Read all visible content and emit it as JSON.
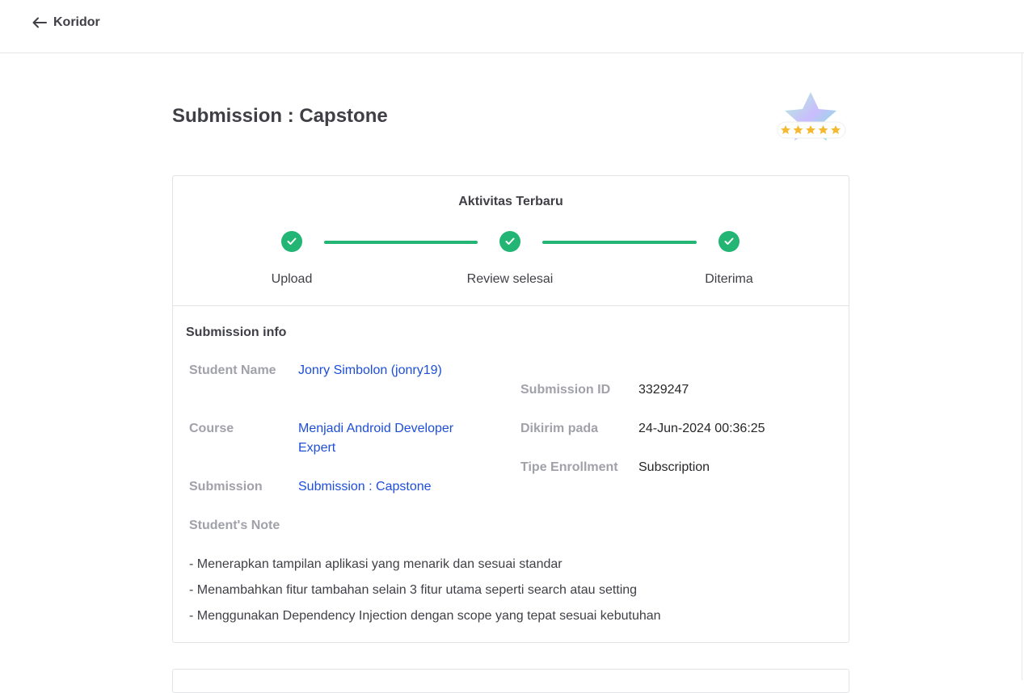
{
  "header": {
    "back_label": "Koridor"
  },
  "page": {
    "title": "Submission : Capstone",
    "badge_icon": "star-rating-badge-icon"
  },
  "activity": {
    "title": "Aktivitas Terbaru",
    "steps": [
      {
        "label": "Upload",
        "done": true
      },
      {
        "label": "Review selesai",
        "done": true
      },
      {
        "label": "Diterima",
        "done": true
      }
    ]
  },
  "info": {
    "section_title": "Submission info",
    "left": {
      "student_label": "Student Name",
      "student_value": "Jonry Simbolon (jonry19)",
      "course_label": "Course",
      "course_value": "Menjadi Android Developer Expert",
      "submission_label": "Submission",
      "submission_value": "Submission : Capstone",
      "note_label": "Student's Note"
    },
    "right": {
      "id_label": "Submission ID",
      "id_value": "3329247",
      "sent_label": "Dikirim pada",
      "sent_value": "24-Jun-2024 00:36:25",
      "enroll_label": "Tipe Enrollment",
      "enroll_value": "Subscription"
    },
    "notes": [
      "- Menerapkan tampilan aplikasi yang menarik dan sesuai standar",
      "- Menambahkan fitur tambahan selain 3 fitur utama seperti search atau setting",
      "- Menggunakan Dependency Injection dengan scope yang tepat sesuai kebutuhan"
    ]
  },
  "colors": {
    "success": "#22b573",
    "link": "#1d4ed8",
    "label_gray": "#a1a1aa",
    "star": "#f5b82e"
  }
}
